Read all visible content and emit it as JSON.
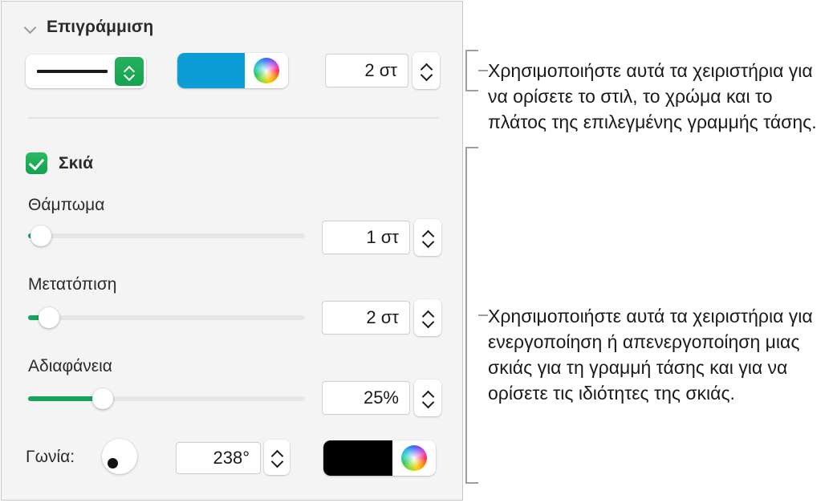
{
  "panel": {
    "section": {
      "title": "Επιγράμμιση",
      "collapse_icon": "chevron-down-icon"
    },
    "stroke": {
      "style_preview": "solid-line",
      "style_stepper_icon": "stepper-up-down-icon",
      "color_swatch": "#0d9dd6",
      "color_wheel_icon": "color-wheel-icon",
      "width_value": "2 στ",
      "width_stepper_icon": "stepper-up-down-icon"
    },
    "shadow": {
      "checkbox_label": "Σκιά",
      "checkbox_checked": true,
      "blur": {
        "label": "Θάμπωμα",
        "value": "1 στ",
        "slider_percent": 1
      },
      "offset": {
        "label": "Μετατόπιση",
        "value": "2 στ",
        "slider_percent": 4
      },
      "opacity": {
        "label": "Αδιαφάνεια",
        "value": "25%",
        "slider_percent": 25
      },
      "angle": {
        "label": "Γωνία:",
        "value": "238°",
        "wheel_icon": "angle-dial-icon",
        "stepper_icon": "stepper-up-down-icon"
      },
      "color_swatch": "#000000",
      "color_wheel_icon": "color-wheel-icon"
    }
  },
  "callouts": [
    {
      "id": "stroke-callout",
      "text": "Χρησιμοποιήστε αυτά τα χειριστήρια για να ορίσετε το στιλ, το χρώμα και το πλάτος της επιλεγμένης γραμμής τάσης."
    },
    {
      "id": "shadow-callout",
      "text": "Χρησιμοποιήστε αυτά τα χειριστήρια για ενεργοποίηση ή απενεργοποίηση μιας σκιάς για τη γραμμή τάσης και για να ορίσετε τις ιδιότητες της σκιάς."
    }
  ],
  "colors": {
    "accent_green": "#16a35a",
    "panel_background": "#f4f4f4",
    "bracket": "#9d9d9d"
  }
}
